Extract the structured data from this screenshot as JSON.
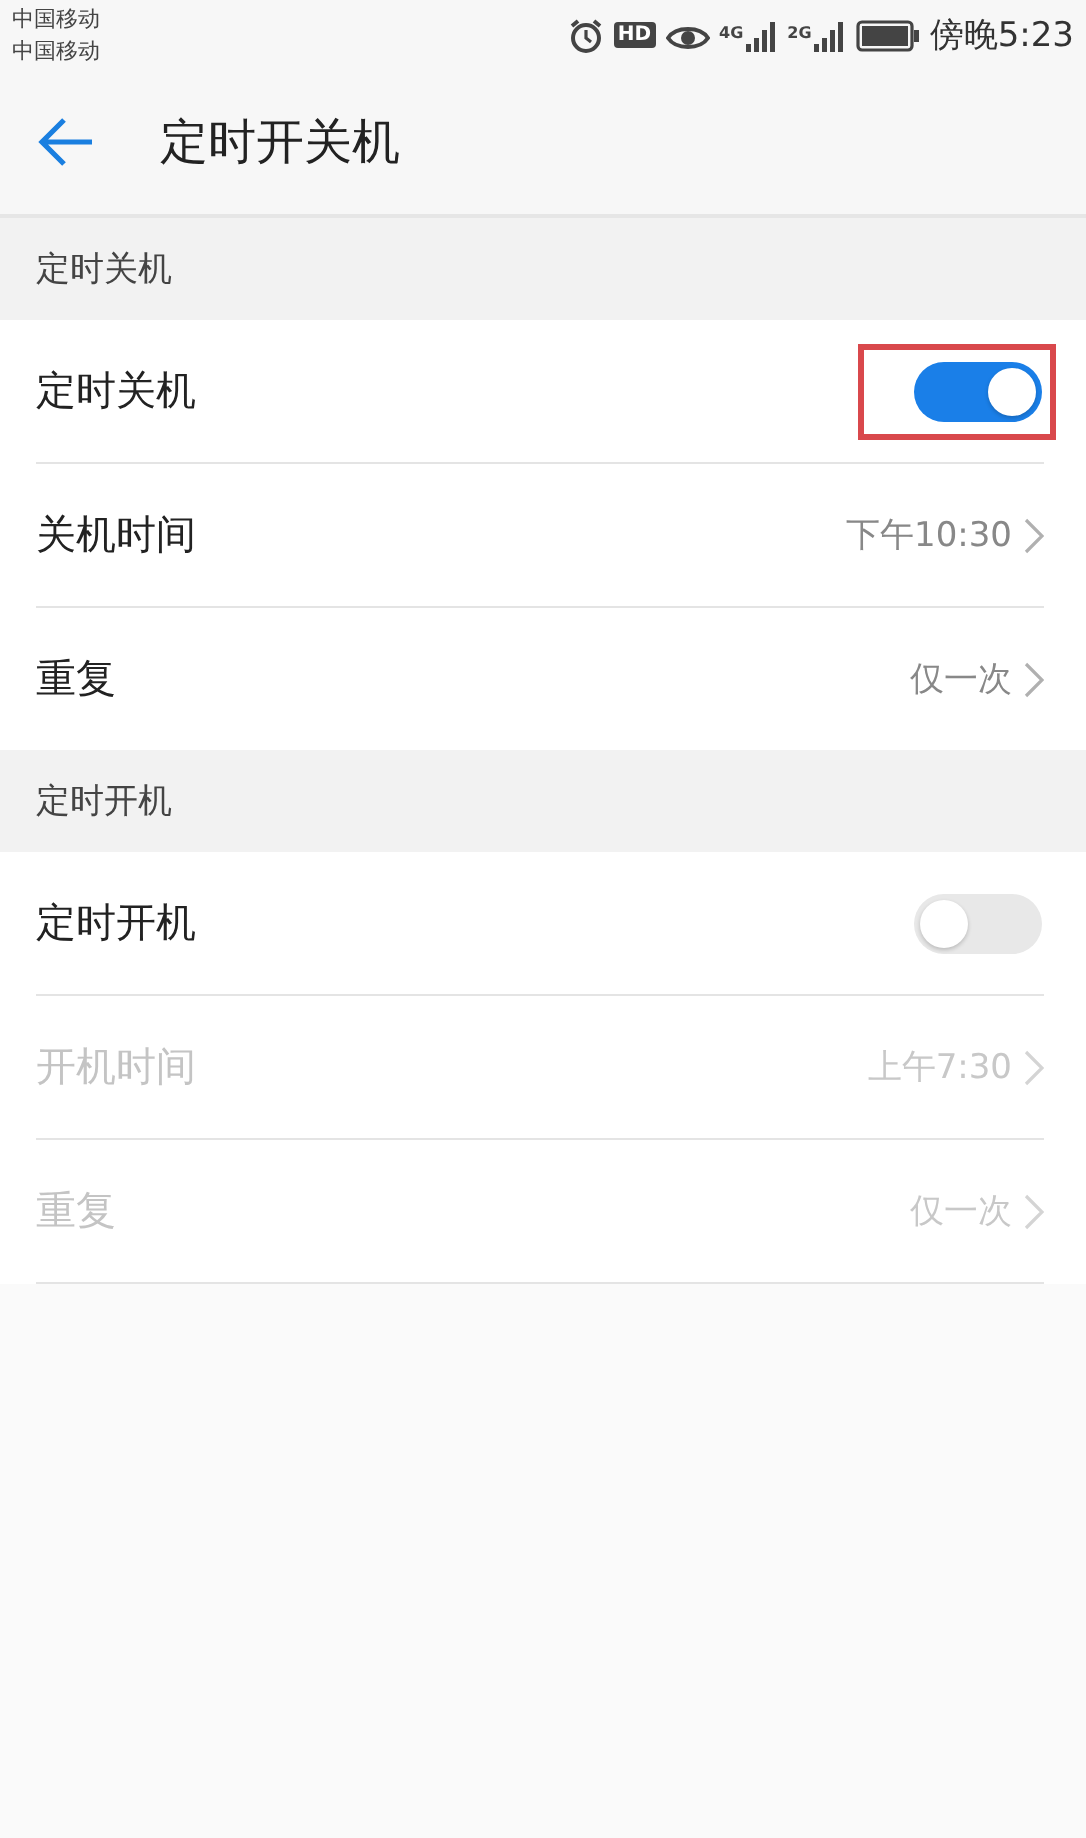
{
  "status_bar": {
    "carriers": [
      "中国移动",
      "中国移动"
    ],
    "hd_badge": "HD",
    "network_1": "4G",
    "network_2": "2G",
    "time": "傍晚5:23"
  },
  "header": {
    "title": "定时开关机"
  },
  "sections": [
    {
      "title": "定时关机",
      "rows": [
        {
          "kind": "toggle",
          "label": "定时关机",
          "on": true,
          "highlighted": true,
          "disabled": false
        },
        {
          "kind": "value",
          "label": "关机时间",
          "value": "下午10:30",
          "disabled": false
        },
        {
          "kind": "value",
          "label": "重复",
          "value": "仅一次",
          "disabled": false
        }
      ]
    },
    {
      "title": "定时开机",
      "rows": [
        {
          "kind": "toggle",
          "label": "定时开机",
          "on": false,
          "highlighted": false,
          "disabled": false
        },
        {
          "kind": "value",
          "label": "开机时间",
          "value": "上午7:30",
          "disabled": true
        },
        {
          "kind": "value",
          "label": "重复",
          "value": "仅一次",
          "disabled": true
        }
      ]
    }
  ]
}
